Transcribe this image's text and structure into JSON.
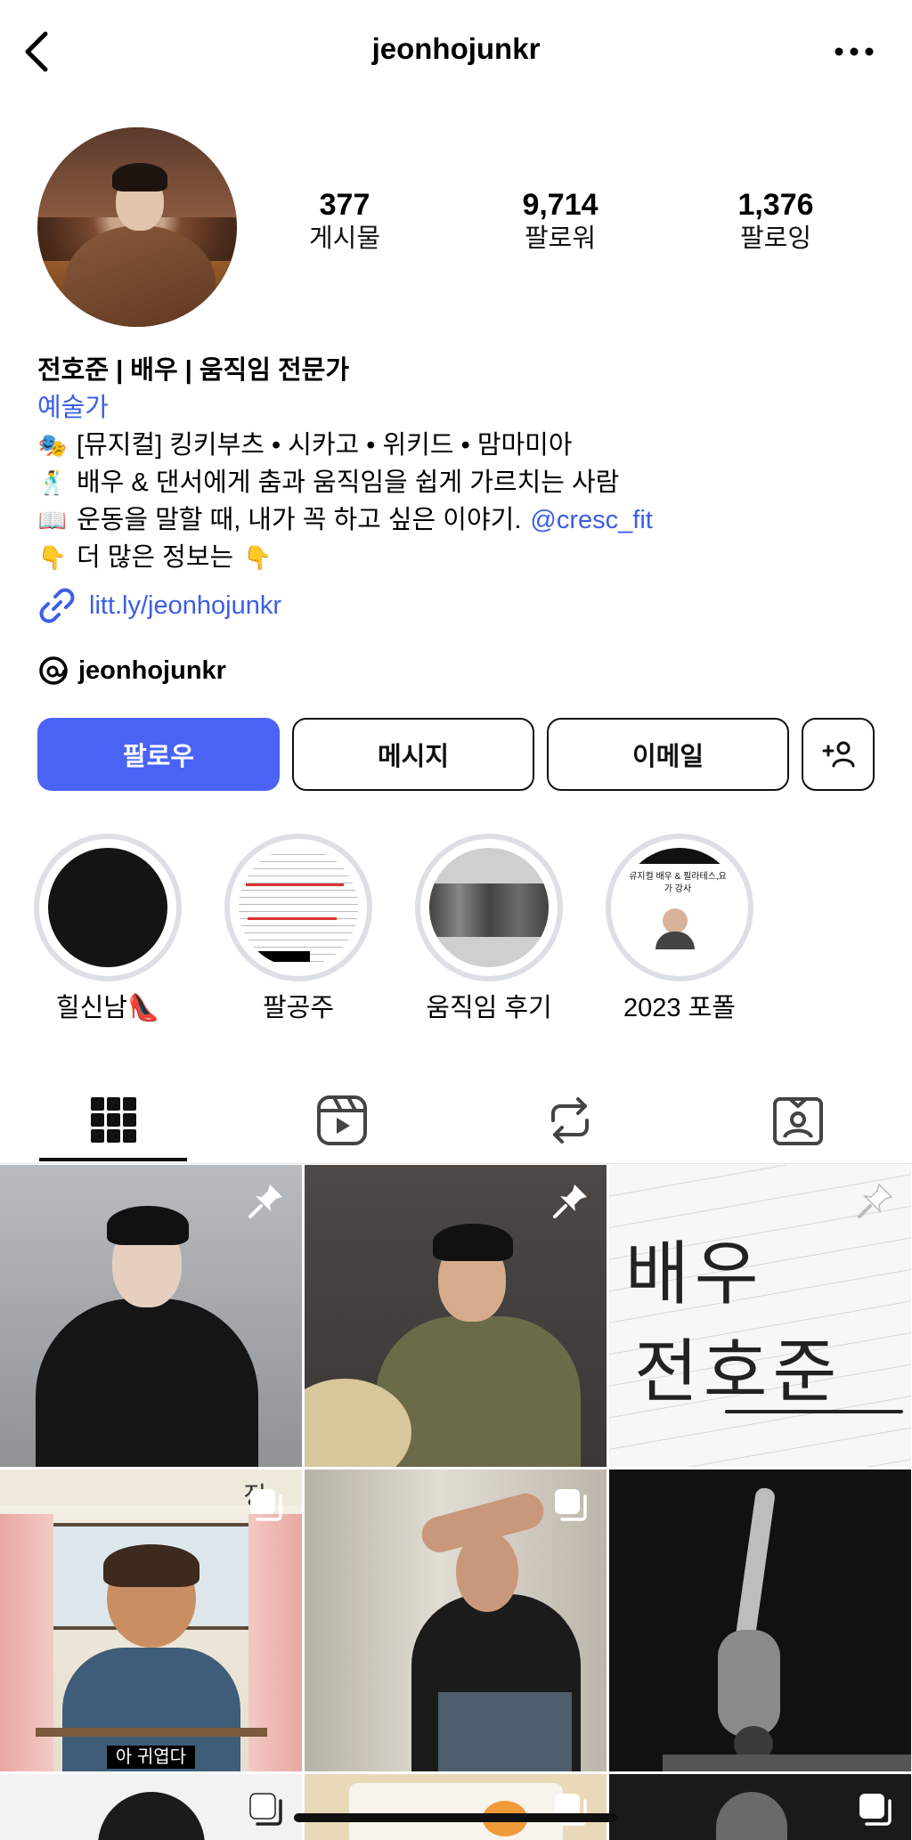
{
  "header": {
    "title": "jeonhojunkr"
  },
  "stats": [
    {
      "value": "377",
      "label": "게시물"
    },
    {
      "value": "9,714",
      "label": "팔로워"
    },
    {
      "value": "1,376",
      "label": "팔로잉"
    }
  ],
  "bio": {
    "name": "전호준 | 배우 | 움직임 전문가",
    "category": "예술가",
    "lines": [
      {
        "emoji": "🎭",
        "text": "[뮤지컬] 킹키부츠 • 시카고 • 위키드 • 맘마미아"
      },
      {
        "emoji": "🕺",
        "text": "배우 & 댄서에게 춤과 움직임을 쉽게 가르치는 사람"
      },
      {
        "emoji": "📖",
        "text": "운동을 말할 때, 내가 꼭 하고 싶은 이야기.",
        "mention": "@cresc_fit"
      },
      {
        "emoji": "👇",
        "text": "더 많은 정보는",
        "emoji_end": "👇"
      }
    ],
    "link": "litt.ly/jeonhojunkr",
    "threads": "jeonhojunkr"
  },
  "buttons": {
    "follow": "팔로우",
    "message": "메시지",
    "email": "이메일"
  },
  "highlights": [
    {
      "label": "힐신남👠",
      "overlay": ""
    },
    {
      "label": "팔공주",
      "overlay": ""
    },
    {
      "label": "움직임 후기",
      "overlay": ""
    },
    {
      "label": "2023 포폴",
      "overlay": "뮤지컬 배우 & 필라테스,요가 강사"
    }
  ],
  "tabs": [
    "grid-icon",
    "reels-icon",
    "reposts-icon",
    "tagged-icon"
  ],
  "grid": {
    "tile3_text": [
      "배우",
      "전호준"
    ],
    "tile4_corner": "정",
    "tile4_caption": "아 귀엽다"
  },
  "colors": {
    "accent": "#4a63f5",
    "link": "#3b5ee6",
    "ring": "#dcdfe4"
  }
}
